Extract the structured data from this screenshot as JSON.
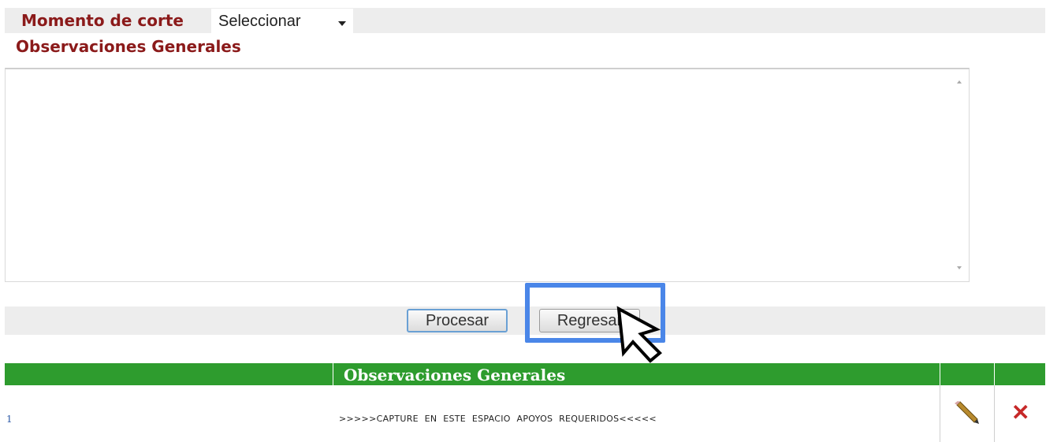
{
  "filters": {
    "momento_label": "Momento de corte",
    "momento_select_value": "Seleccionar"
  },
  "observaciones": {
    "label": "Observaciones Generales",
    "textarea_value": ""
  },
  "actions": {
    "procesar_label": "Procesar",
    "regresar_label": "Regresar"
  },
  "grid": {
    "header_title": "Observaciones Generales",
    "header_color": "#2e9c2e",
    "rows": [
      {
        "number": "1",
        "text": ">>>>>CAPTURE EN ESTE ESPACIO APOYOS REQUERIDOS<<<<<",
        "edit_icon": "pencil-icon",
        "delete_icon": "close-icon"
      }
    ]
  },
  "annotation": {
    "highlight_color": "#4a86e8",
    "cursor_icon": "arrow-cursor-icon"
  },
  "accent_color": "#8b1a1a"
}
